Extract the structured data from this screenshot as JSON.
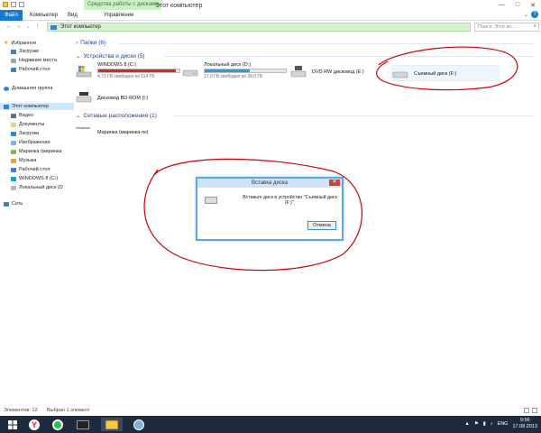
{
  "titlebar": {
    "context_tab": "Средства работы с дисками",
    "title": "Этот компьютер",
    "controls": [
      "—",
      "□",
      "✕"
    ]
  },
  "ribbon": {
    "tabs": [
      "Файл",
      "Компьютер",
      "Вид",
      "Управление"
    ]
  },
  "address": {
    "path": "Этот компьютер",
    "search_placeholder": "Поиск: Этот ко..."
  },
  "sidebar": {
    "favorites": {
      "label": "Избранное",
      "items": [
        "Загрузки",
        "Недавние места",
        "Рабочий стол"
      ]
    },
    "homegroup": {
      "label": "Домашняя группа"
    },
    "this_pc": {
      "label": "Этот компьютер",
      "items": [
        "Видео",
        "Документы",
        "Загрузки",
        "Изображения",
        "Маринка (маринка",
        "Музыка",
        "Рабочий стол",
        "WINDOWS 8 (C:)",
        "Локальный диск (D"
      ]
    },
    "network": {
      "label": "Сеть"
    }
  },
  "main": {
    "folders_header": "Папки (6)",
    "devices_header": "Устройства и диски (5)",
    "network_header": "Сетевые расположения (1)",
    "drives": [
      {
        "name": "WINDOWS 8 (C:)",
        "free": "4,72 ГБ свободно из 114 ГБ",
        "used_fraction": 0.96,
        "color": "#da2626"
      },
      {
        "name": "Локальный диск (D:)",
        "free": "17,0 ГБ свободно из 39,0 ГБ",
        "used_fraction": 0.56,
        "color": "#26a0da"
      },
      {
        "name": "DVD RW дисковод (E:)"
      },
      {
        "name": "Съемный диск (F:)"
      },
      {
        "name": "Дисковод BD-ROM (I:)"
      }
    ],
    "network_item": {
      "name": "Маринка (маринка-пк)",
      "logo_text": "Windows"
    }
  },
  "dialog": {
    "title": "Вставка диска",
    "message": "Вставьте диск в устройство \"Съемный диск (F:)\".",
    "button": "Отмена",
    "close": "✕"
  },
  "statusbar": {
    "items_count": "Элементов: 12",
    "selected": "Выбран 1 элемент"
  },
  "taskbar": {
    "lang": "ENG",
    "time": "9:56",
    "date": "17.08.2013"
  },
  "colors": {
    "accent": "#1979ca",
    "selection": "#cce8ff",
    "annotation": "#d10000"
  }
}
